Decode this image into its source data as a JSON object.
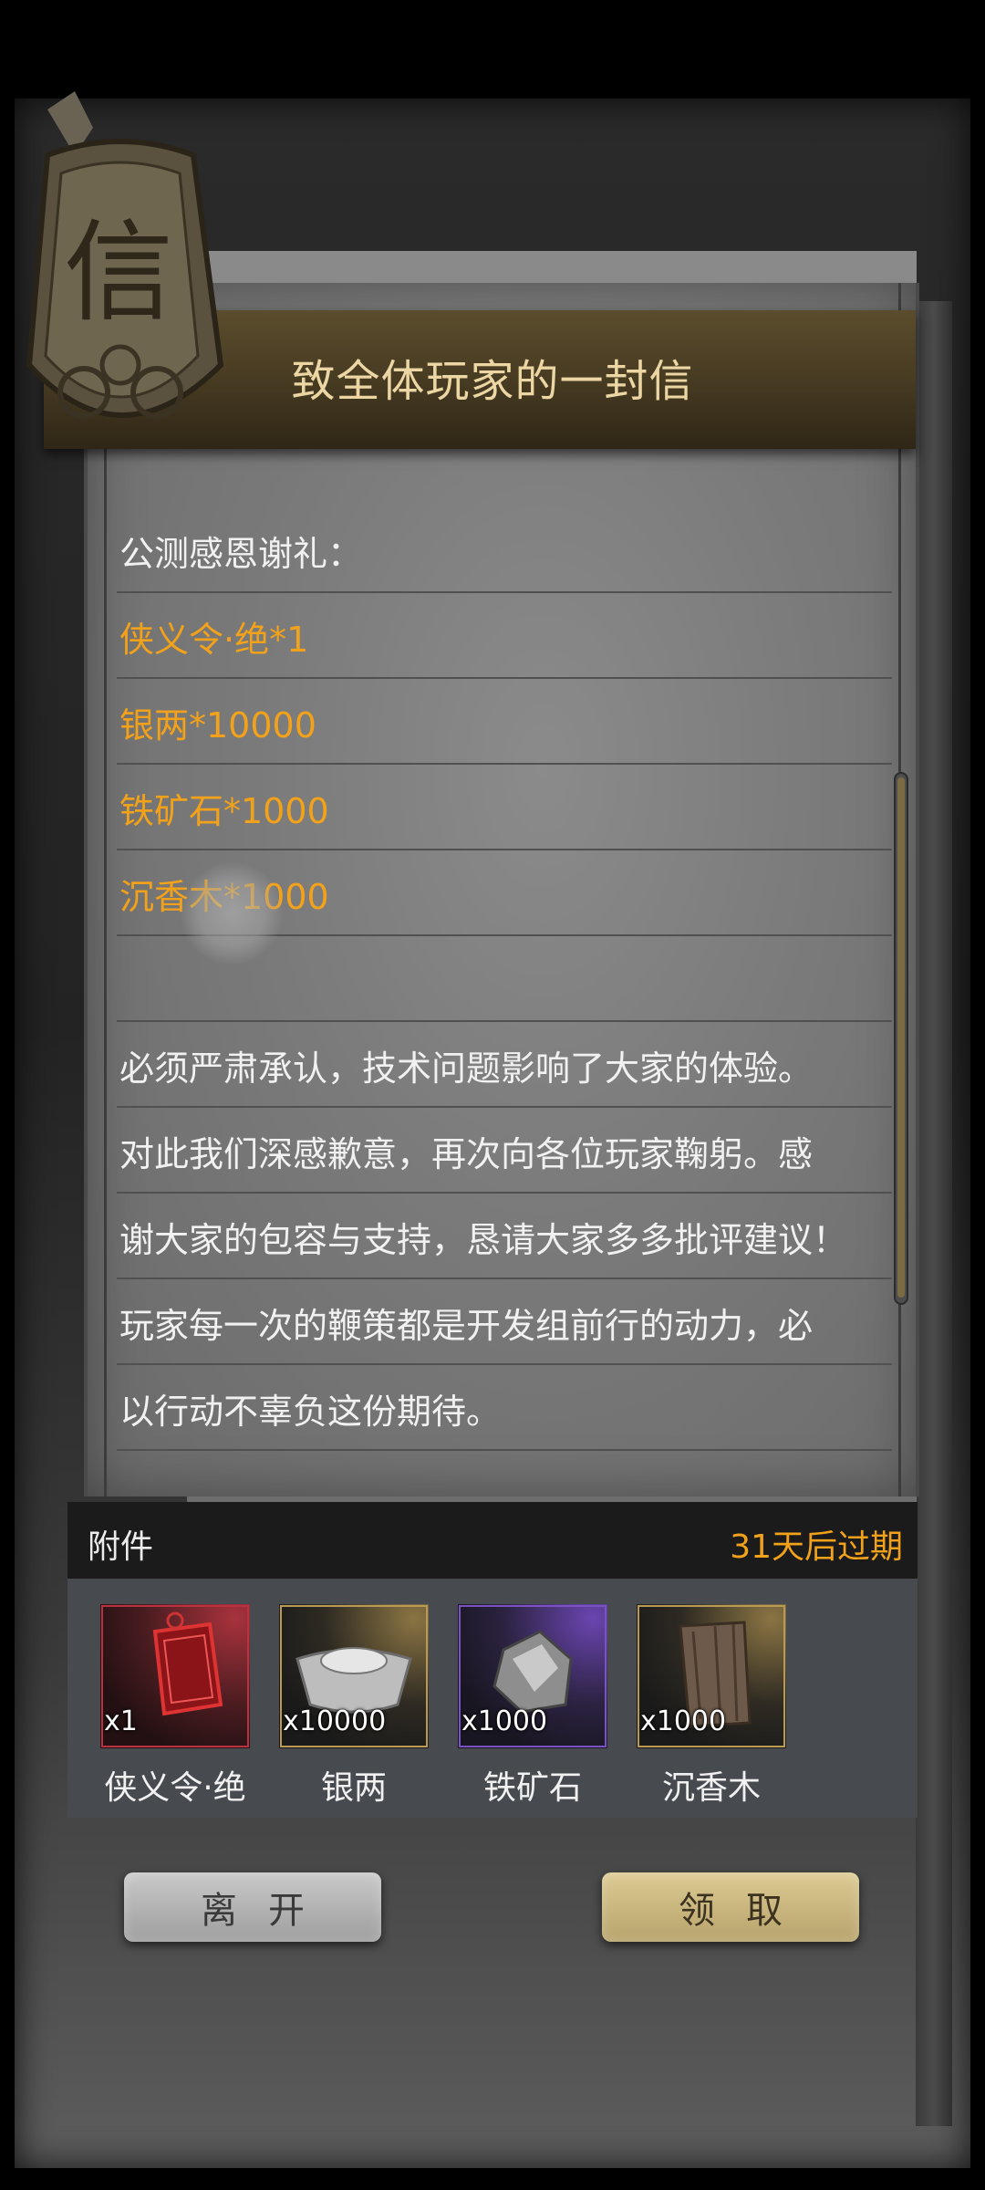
{
  "header": {
    "title": "致全体玩家的一封信",
    "seal_char": "信"
  },
  "letter": {
    "lines": [
      {
        "text": "公测感恩谢礼：",
        "highlight": false
      },
      {
        "text": "侠义令·绝*1",
        "highlight": true
      },
      {
        "text": "银两*10000",
        "highlight": true
      },
      {
        "text": "铁矿石*1000",
        "highlight": true
      },
      {
        "text": "沉香木*1000",
        "highlight": true
      },
      {
        "text": "",
        "highlight": false
      },
      {
        "text": "必须严肃承认，技术问题影响了大家的体验。",
        "highlight": false
      },
      {
        "text": "对此我们深感歉意，再次向各位玩家鞠躬。感",
        "highlight": false
      },
      {
        "text": "谢大家的包容与支持，恳请大家多多批评建议！",
        "highlight": false
      },
      {
        "text": "玩家每一次的鞭策都是开发组前行的动力，必",
        "highlight": false
      },
      {
        "text": "以行动不辜负这份期待。",
        "highlight": false
      }
    ]
  },
  "attachments": {
    "label": "附件",
    "expire": "31天后过期",
    "items": [
      {
        "name": "侠义令·绝",
        "qty": "x1",
        "icon": "red-token-icon",
        "rarity_color": "#b8323f"
      },
      {
        "name": "银两",
        "qty": "x10000",
        "icon": "silver-ingot-icon",
        "rarity_color": "#b89a55"
      },
      {
        "name": "铁矿石",
        "qty": "x1000",
        "icon": "iron-ore-icon",
        "rarity_color": "#7a52c2"
      },
      {
        "name": "沉香木",
        "qty": "x1000",
        "icon": "agarwood-icon",
        "rarity_color": "#b89a55"
      }
    ]
  },
  "buttons": {
    "leave": "离开",
    "claim": "领取"
  },
  "colors": {
    "highlight": "#f2a21a",
    "title": "#ecd7a4"
  }
}
